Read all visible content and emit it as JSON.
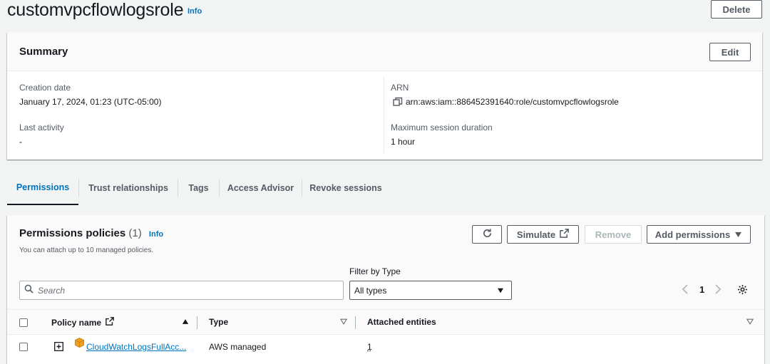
{
  "header": {
    "title": "customvpcflowlogsrole",
    "info": "Info",
    "delete_label": "Delete"
  },
  "summary": {
    "title": "Summary",
    "edit_label": "Edit",
    "creation_date_label": "Creation date",
    "creation_date_value": "January 17, 2024, 01:23 (UTC-05:00)",
    "last_activity_label": "Last activity",
    "last_activity_value": "-",
    "arn_label": "ARN",
    "arn_value": "arn:aws:iam::886452391640:role/customvpcflowlogsrole",
    "max_session_label": "Maximum session duration",
    "max_session_value": "1 hour"
  },
  "tabs": [
    "Permissions",
    "Trust relationships",
    "Tags",
    "Access Advisor",
    "Revoke sessions"
  ],
  "permissions": {
    "title": "Permissions policies",
    "count": "(1)",
    "info": "Info",
    "description": "You can attach up to 10 managed policies.",
    "simulate_label": "Simulate",
    "remove_label": "Remove",
    "add_label": "Add permissions",
    "filter_label": "Filter by Type",
    "filter_value": "All types",
    "search_placeholder": "Search",
    "page": "1",
    "columns": [
      "Policy name",
      "Type",
      "Attached entities"
    ],
    "rows": [
      {
        "name": "CloudWatchLogsFullAcc...",
        "type": "AWS managed",
        "entities": "1"
      }
    ]
  },
  "colors": {
    "link": "#0073bb",
    "background": "#f2f3f3",
    "policy_icon": "#f0a020"
  },
  "icons": [
    "copy-icon",
    "refresh-icon",
    "external-link-icon",
    "caret-down-icon",
    "search-icon",
    "settings-icon",
    "expand-icon",
    "policy-icon"
  ]
}
